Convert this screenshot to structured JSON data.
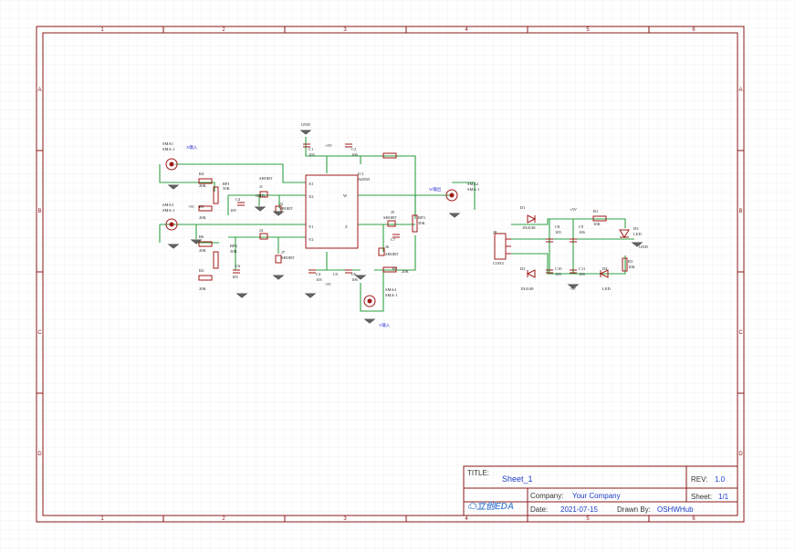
{
  "titleblock": {
    "title_label": "TITLE:",
    "title": "Sheet_1",
    "rev_label": "REV:",
    "rev": "1.0",
    "company_label": "Company:",
    "company": "Your Company",
    "sheet_label": "Sheet:",
    "sheet": "1/1",
    "date_label": "Date:",
    "date": "2021-07-15",
    "drawn_label": "Drawn By:",
    "drawn": "OSHWHub",
    "logo": "立创EDA"
  },
  "frame": {
    "cols": [
      "1",
      "2",
      "3",
      "4",
      "5",
      "6"
    ],
    "rows": [
      "A",
      "B",
      "C",
      "D"
    ]
  },
  "schematic": {
    "labels": [
      "SMA1",
      "SMA-1",
      "X输入",
      "R4",
      "20K",
      "RP1",
      "50K",
      "J1",
      "SHORT",
      "C4",
      "105",
      "J2",
      "SHORT",
      "GND",
      "SMA3",
      "SMA-1",
      "-5V",
      "R5",
      "20K",
      "Y1",
      "Y2",
      "X1",
      "X2",
      "IC1",
      "AD835",
      "W",
      "Z",
      "R6",
      "20K",
      "RP2",
      "50K",
      "J4",
      "J7",
      "SHORT",
      "C6",
      "105",
      "SMA4",
      "SMA-1",
      "Y输入",
      "R2",
      "20K",
      "C1",
      "105",
      "C2",
      "106",
      "C3",
      "C5",
      "105",
      "C6",
      "106",
      "R7",
      "20K",
      "J5",
      "SHORT",
      "J6",
      "SHORT",
      "C7",
      "RP3",
      "50K",
      "SMA2",
      "SMA-1",
      "W输出",
      "GND",
      "+5V",
      "-5V",
      "D1",
      "1N4148",
      "D2",
      "1N4148",
      "J8",
      "CON3",
      "C8",
      "105",
      "C9",
      "106",
      "C10",
      "105",
      "C11",
      "106",
      "R1",
      "10K",
      "R3",
      "10K",
      "D3",
      "LED",
      "D4",
      "LED",
      "GND",
      "+5V",
      "-5V"
    ]
  },
  "colors": {
    "border": "#8b1a1a",
    "wire": "#2ea043",
    "part": "#a01818",
    "text": "#1a1a8c"
  }
}
